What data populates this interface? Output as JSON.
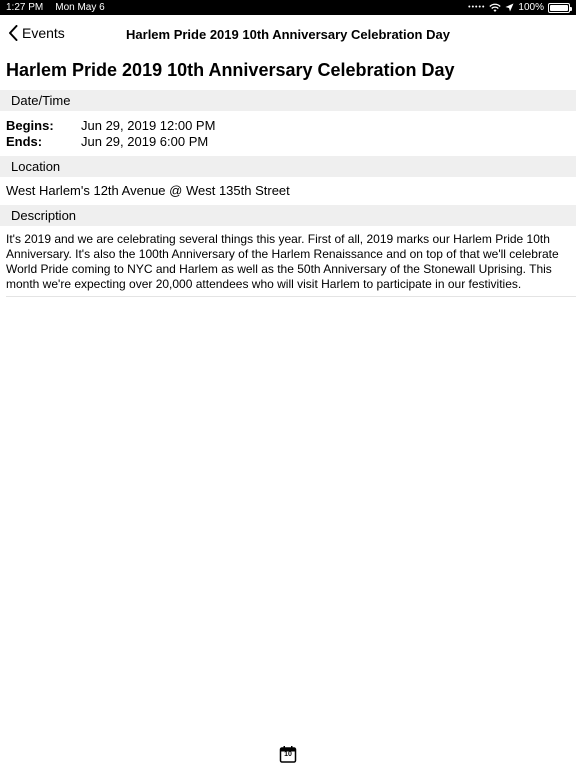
{
  "status_bar": {
    "time": "1:27 PM",
    "date": "Mon May 6",
    "battery": "100%"
  },
  "nav": {
    "back_label": "Events",
    "title": "Harlem Pride 2019 10th Anniversary Celebration Day"
  },
  "event": {
    "title": "Harlem Pride 2019 10th Anniversary Celebration Day",
    "datetime_header": "Date/Time",
    "begins_label": "Begins:",
    "begins_value": "Jun 29, 2019 12:00 PM",
    "ends_label": "Ends:",
    "ends_value": "Jun 29, 2019 6:00 PM",
    "location_header": "Location",
    "location": "West Harlem's 12th Avenue @ West 135th Street",
    "description_header": "Description",
    "description": "It's 2019 and we are celebrating several things this year. First of all, 2019 marks our Harlem Pride 10th Anniversary. It's also the 100th Anniversary of the Harlem Renaissance and on top of that we'll celebrate World Pride coming to NYC and Harlem as well as the 50th Anniversary of the Stonewall Uprising. This month we're expecting over 20,000 attendees who will visit Harlem to participate in our festivities."
  },
  "tab_bar": {
    "calendar_day": "10"
  }
}
